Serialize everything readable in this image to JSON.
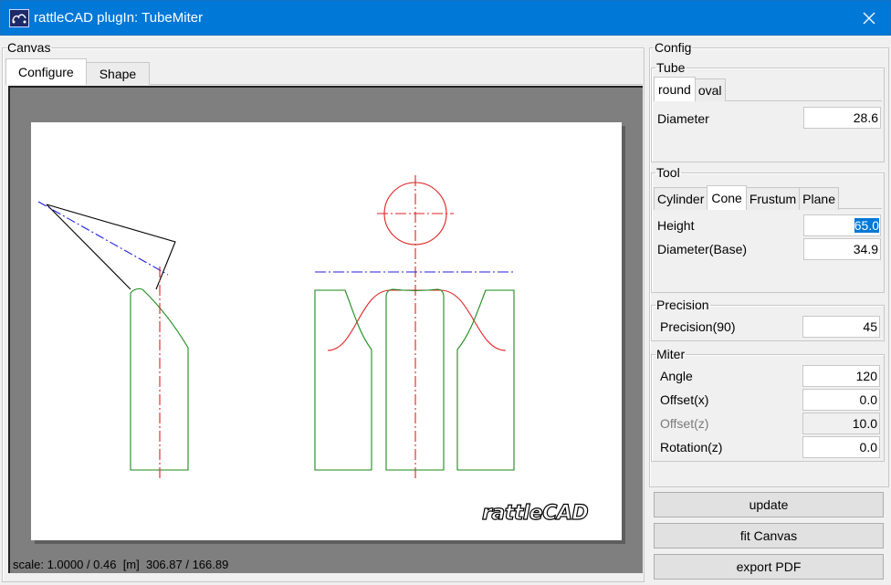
{
  "window": {
    "title": "rattleCAD plugIn: TubeMiter",
    "close_glyph": "✕"
  },
  "canvas": {
    "legend": "Canvas",
    "tabs": [
      {
        "label": "Configure",
        "active": true
      },
      {
        "label": "Shape",
        "active": false
      }
    ],
    "status": "scale: 1.0000 / 0.46  [m]  306.87 / 166.89",
    "logo_text": "rattleCAD"
  },
  "config": {
    "legend": "Config",
    "tube": {
      "legend": "Tube",
      "tabs": [
        {
          "label": "round",
          "active": true
        },
        {
          "label": "oval",
          "active": false
        }
      ],
      "diameter_label": "Diameter",
      "diameter_value": "28.6"
    },
    "tool": {
      "legend": "Tool",
      "tabs": [
        {
          "label": "Cylinder",
          "active": false
        },
        {
          "label": "Cone",
          "active": true
        },
        {
          "label": "Frustum",
          "active": false
        },
        {
          "label": "Plane",
          "active": false
        }
      ],
      "height_label": "Height",
      "height_value": "65.0",
      "diameter_base_label": "Diameter(Base)",
      "diameter_base_value": "34.9"
    },
    "precision": {
      "legend": "Precision",
      "label": "Precision(90)",
      "value": "45"
    },
    "miter": {
      "legend": "Miter",
      "angle_label": "Angle",
      "angle_value": "120",
      "offset_x_label": "Offset(x)",
      "offset_x_value": "0.0",
      "offset_z_label": "Offset(z)",
      "offset_z_value": "10.0",
      "rotation_z_label": "Rotation(z)",
      "rotation_z_value": "0.0"
    }
  },
  "buttons": {
    "update": "update",
    "fit_canvas": "fit Canvas",
    "export_pdf": "export PDF"
  },
  "colors": {
    "titlebar": "#0078d7",
    "tube_outline": "#1b8a1b",
    "miter_curve": "#e02020",
    "axis_line": "#1f1fe0"
  }
}
